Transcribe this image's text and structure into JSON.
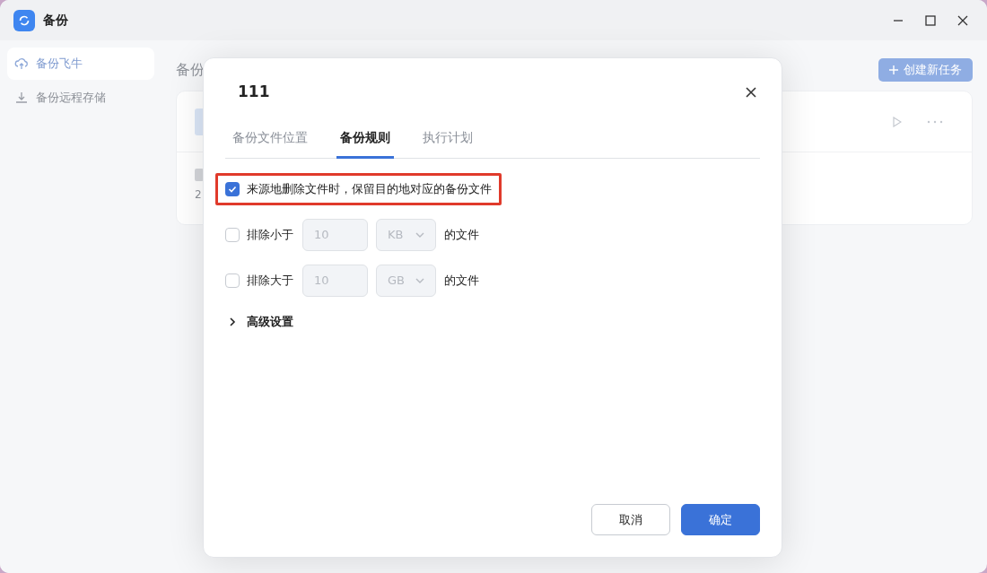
{
  "window": {
    "title": "备份"
  },
  "sidebar": {
    "items": [
      {
        "label": "备份飞牛",
        "selected": true
      },
      {
        "label": "备份远程存储",
        "selected": false
      }
    ]
  },
  "main": {
    "heading": "备份",
    "create_button": "创建新任务",
    "card": {
      "column_1": "2"
    }
  },
  "dialog": {
    "title": "111",
    "tabs": [
      {
        "label": "备份文件位置",
        "selected": false
      },
      {
        "label": "备份规则",
        "selected": true
      },
      {
        "label": "执行计划",
        "selected": false
      }
    ],
    "rules": [
      {
        "kind": "check",
        "label": "来源地删除文件时，保留目的地对应的备份文件",
        "checked": true,
        "highlighted": true
      },
      {
        "kind": "size",
        "label": "排除小于",
        "checked": false,
        "value": "10",
        "unit": "KB",
        "suffix": "的文件"
      },
      {
        "kind": "size",
        "label": "排除大于",
        "checked": false,
        "value": "10",
        "unit": "GB",
        "suffix": "的文件"
      }
    ],
    "advanced": {
      "label": "高级设置",
      "expanded": false
    },
    "buttons": [
      {
        "label": "取消",
        "kind": "secondary"
      },
      {
        "label": "确定",
        "kind": "primary"
      }
    ]
  }
}
